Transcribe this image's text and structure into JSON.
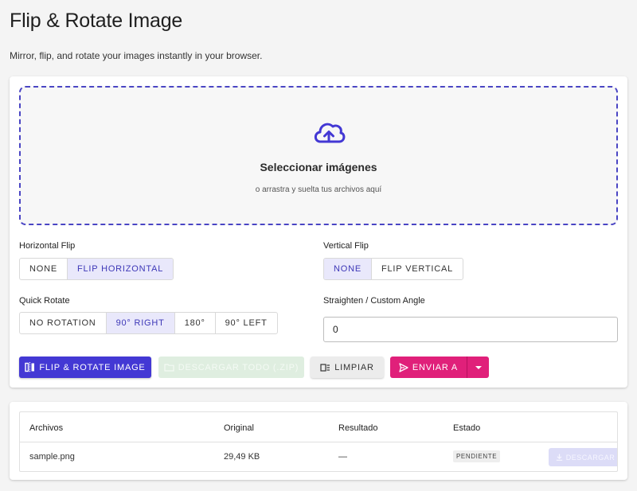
{
  "header": {
    "title": "Flip & Rotate Image",
    "subtitle": "Mirror, flip, and rotate your images instantly in your browser."
  },
  "dropzone": {
    "icon": "cloud-upload-icon",
    "title": "Seleccionar imágenes",
    "hint": "o arrastra y suelta tus archivos aquí"
  },
  "horizontal_flip": {
    "label": "Horizontal Flip",
    "options": [
      "NONE",
      "FLIP HORIZONTAL"
    ],
    "selected": "FLIP HORIZONTAL"
  },
  "vertical_flip": {
    "label": "Vertical Flip",
    "options": [
      "NONE",
      "FLIP VERTICAL"
    ],
    "selected": "NONE"
  },
  "quick_rotate": {
    "label": "Quick Rotate",
    "options": [
      "NO ROTATION",
      "90° RIGHT",
      "180°",
      "90° LEFT"
    ],
    "selected": "90° RIGHT"
  },
  "custom_angle": {
    "label": "Straighten / Custom Angle",
    "value": "0"
  },
  "actions": {
    "process_label": "FLIP & ROTATE IMAGE",
    "download_all_label": "DESCARGAR TODO (.ZIP)",
    "clear_label": "LIMPIAR",
    "send_label": "ENVIAR A"
  },
  "files_table": {
    "columns": [
      "Archivos",
      "Original",
      "Resultado",
      "Estado"
    ],
    "rows": [
      {
        "name": "sample.png",
        "original": "29,49 KB",
        "result": "—",
        "status": "PENDIENTE",
        "download_label": "DESCARGAR"
      }
    ]
  },
  "colors": {
    "accent": "#4338d4",
    "send": "#e0207a",
    "selected_segment": "#e9e8fb"
  }
}
